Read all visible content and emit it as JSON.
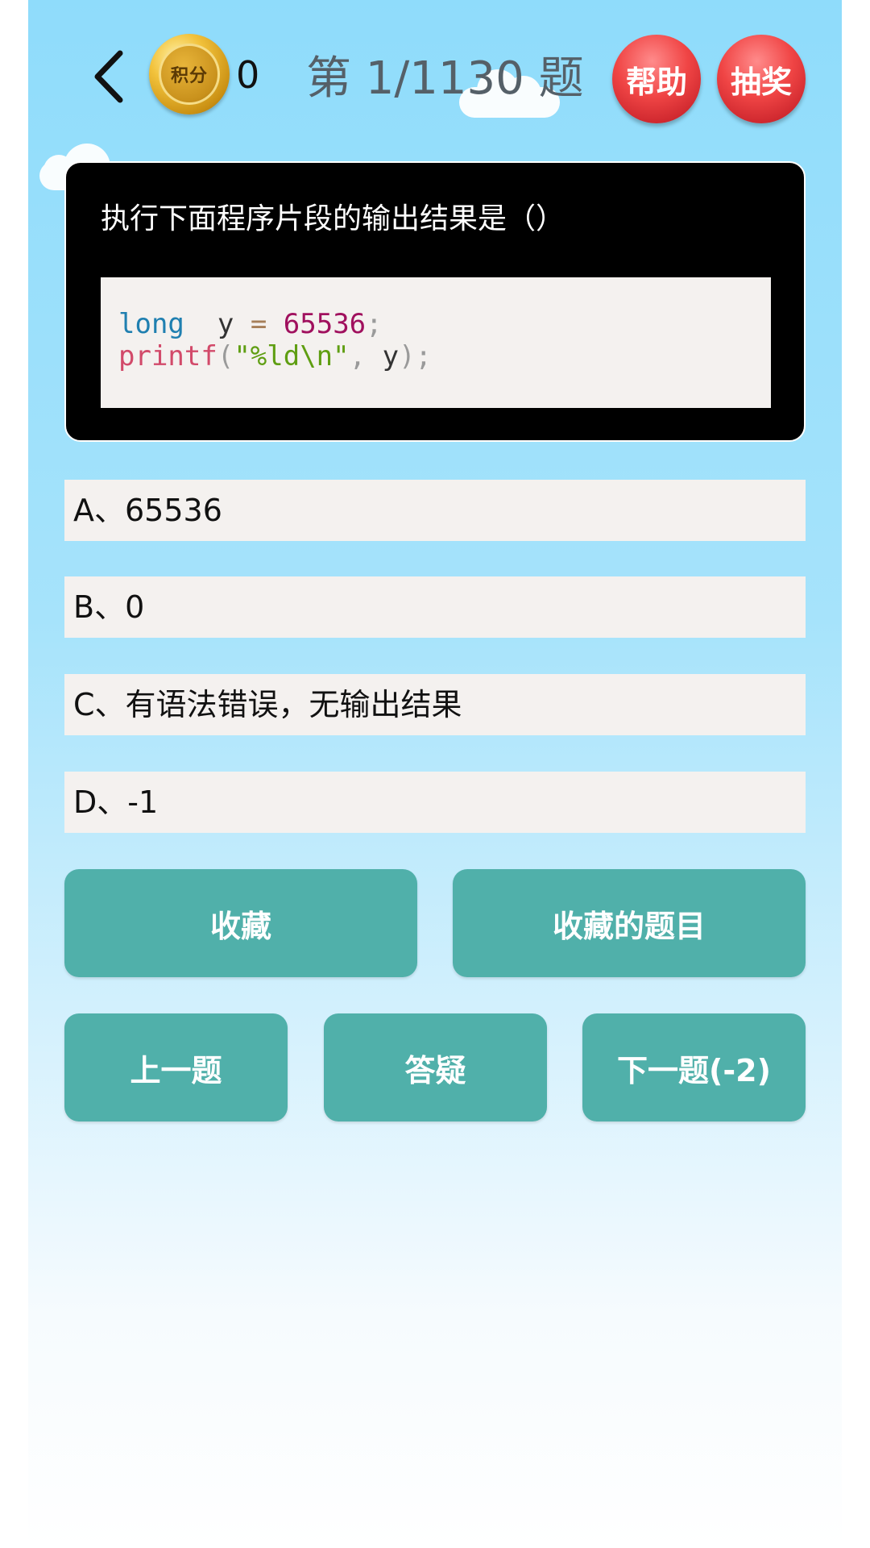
{
  "header": {
    "back_icon": "chevron-left-icon",
    "coin_label": "积分",
    "score": "0",
    "progress": "第 1/1130 题",
    "help_label": "帮助",
    "lottery_label": "抽奖"
  },
  "question": {
    "text": "执行下面程序片段的输出结果是（）",
    "code": {
      "line1": {
        "kw": "long",
        "var": "y",
        "op": "=",
        "num": "65536",
        "end": ";"
      },
      "line2": {
        "fn": "printf",
        "open": "(",
        "str": "\"%ld\\n\"",
        "comma": ",",
        "var": "y",
        "close": ");"
      }
    }
  },
  "options": [
    {
      "label": "A、65536"
    },
    {
      "label": "B、0"
    },
    {
      "label": "C、有语法错误，无输出结果"
    },
    {
      "label": "D、-1"
    }
  ],
  "actions": {
    "favorite": "收藏",
    "favorites_list": "收藏的题目",
    "previous": "上一题",
    "ask": "答疑",
    "next": "下一题(-2)"
  },
  "colors": {
    "accent_button": "#50b0aa",
    "round_button": "#e53e3e",
    "sky": "#8fdcfb"
  }
}
